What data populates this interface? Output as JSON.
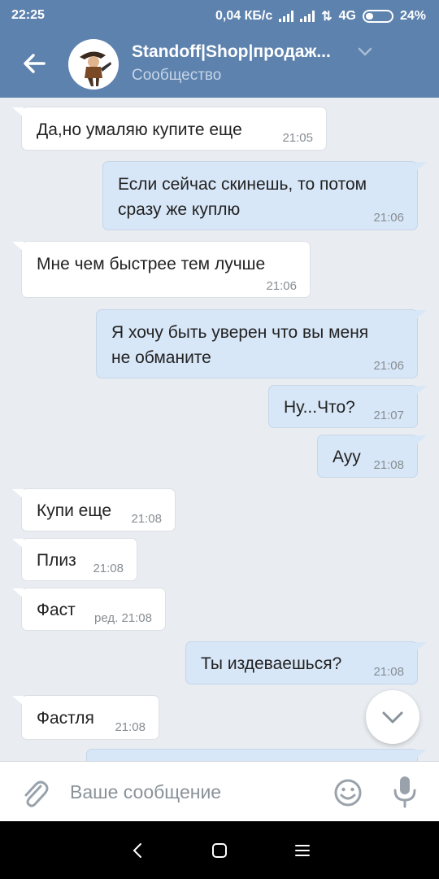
{
  "status_bar": {
    "time": "22:25",
    "speed": "0,04 КБ/с",
    "network": "4G",
    "battery": "24%"
  },
  "header": {
    "title": "Standoff|Shop|продаж...",
    "subtitle": "Сообщество"
  },
  "messages": [
    {
      "dir": "in",
      "text": "Да,но умаляю купите еще",
      "time": "21:05"
    },
    {
      "dir": "out",
      "text": "Если сейчас скинешь, то потом\nсразу же куплю",
      "time": "21:06"
    },
    {
      "dir": "in",
      "text": "Мне чем быстрее тем лучше",
      "time": "21:06"
    },
    {
      "dir": "out",
      "text": "Я хочу быть уверен что вы меня\nне обманите",
      "time": "21:06"
    },
    {
      "dir": "out",
      "text": "Ну...Что?",
      "time": "21:07"
    },
    {
      "dir": "out",
      "text": "Ауу",
      "time": "21:08"
    },
    {
      "dir": "in",
      "text": "Купи еще",
      "time": "21:08"
    },
    {
      "dir": "in",
      "text": "Плиз",
      "time": "21:08"
    },
    {
      "dir": "in",
      "text": "Фаст",
      "time": "ред. 21:08"
    },
    {
      "dir": "out",
      "text": "Ты издеваешься?",
      "time": "21:08"
    },
    {
      "dir": "in",
      "text": "Фастля",
      "time": "21:08"
    }
  ],
  "input": {
    "placeholder": "Ваше сообщение"
  },
  "icons": {
    "back": "arrow-left-icon",
    "dropdown": "chevron-down-icon",
    "attach": "paperclip-icon",
    "emoji": "smile-icon",
    "voice": "microphone-icon",
    "scroll": "chevron-down-icon"
  },
  "colors": {
    "header": "#5d82ae",
    "incoming": "#ffffff",
    "outgoing": "#d8e7f8",
    "background": "#e9edf1"
  }
}
